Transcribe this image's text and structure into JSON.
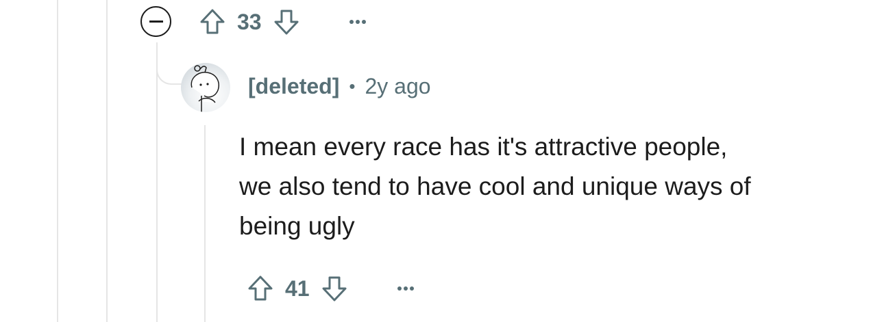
{
  "parent_comment": {
    "score": "33"
  },
  "reply": {
    "author": "[deleted]",
    "separator": "•",
    "time": "2y ago",
    "body_lines": [
      "I mean every race has it's attractive people,",
      "we also tend to have cool and unique ways of",
      "being ugly"
    ],
    "score": "41"
  },
  "icons": {
    "collapse": "collapse-thread-icon",
    "upvote": "upvote-arrow-icon",
    "downvote": "downvote-arrow-icon",
    "more": "more-options-icon",
    "avatar": "snoo-avatar-icon"
  },
  "colors": {
    "meta_gray": "#576f76",
    "text": "#1c1c1c",
    "thread_line": "#e5e5e5"
  }
}
